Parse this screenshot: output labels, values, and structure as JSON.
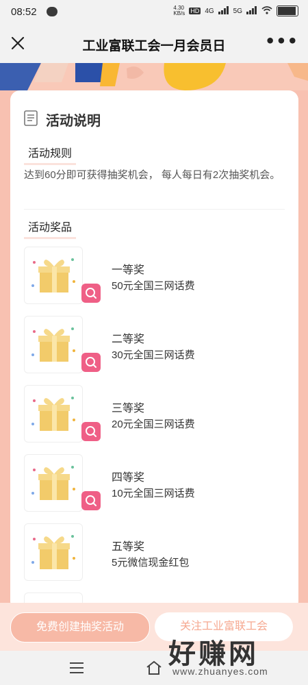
{
  "status_bar": {
    "time": "08:52",
    "net_speed_top": "4.30",
    "net_speed_bottom": "KB/s",
    "network_1": "4G",
    "network_2": "5G"
  },
  "title_bar": {
    "title": "工业富联工会一月会员日"
  },
  "activity": {
    "heading": "活动说明",
    "rules_label": "活动规则",
    "rules_text": "达到60分即可获得抽奖机会， 每人每日有2次抽奖机会。",
    "prizes_label": "活动奖品",
    "prizes": [
      {
        "name": "一等奖",
        "desc": "50元全国三网话费"
      },
      {
        "name": "二等奖",
        "desc": "30元全国三网话费"
      },
      {
        "name": "三等奖",
        "desc": "20元全国三网话费"
      },
      {
        "name": "四等奖",
        "desc": "10元全国三网话费"
      },
      {
        "name": "五等奖",
        "desc": "5元微信现金红包"
      }
    ]
  },
  "buttons": {
    "free_create": "免费创建抽奖活动",
    "follow": "关注工业富联工会"
  },
  "watermark": {
    "big": "好赚网",
    "small": "www.zhuanyes.com"
  },
  "colors": {
    "page_bg": "#f8c1b1",
    "accent_pink": "#ef5f86",
    "gift_gold": "#f2cb6a"
  }
}
